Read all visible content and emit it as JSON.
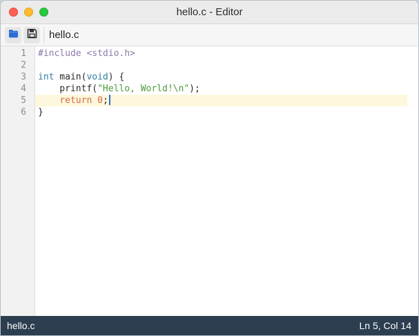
{
  "window": {
    "title": "hello.c - Editor"
  },
  "toolbar": {
    "open_icon": "folder-icon",
    "save_icon": "floppy-save-icon",
    "filename": "hello.c"
  },
  "editor": {
    "line_numbers": [
      "1",
      "2",
      "3",
      "4",
      "5",
      "6"
    ],
    "lines": [
      {
        "segments": [
          {
            "text": "#include <stdio.h>",
            "style": "pp"
          }
        ]
      },
      {
        "segments": []
      },
      {
        "segments": [
          {
            "text": "int",
            "style": "kw"
          },
          {
            "text": " main(",
            "style": ""
          },
          {
            "text": "void",
            "style": "kw"
          },
          {
            "text": ") {",
            "style": ""
          }
        ]
      },
      {
        "segments": [
          {
            "text": "    printf(",
            "style": ""
          },
          {
            "text": "\"Hello, World!\\n\"",
            "style": "str"
          },
          {
            "text": ");",
            "style": ""
          }
        ]
      },
      {
        "segments": [
          {
            "text": "    ",
            "style": ""
          },
          {
            "text": "return",
            "style": "ret"
          },
          {
            "text": " ",
            "style": ""
          },
          {
            "text": "0",
            "style": "ret"
          },
          {
            "text": ";",
            "style": ""
          }
        ],
        "active": true,
        "cursor": true
      },
      {
        "segments": [
          {
            "text": "}",
            "style": ""
          }
        ]
      }
    ]
  },
  "statusbar": {
    "filename": "hello.c",
    "position": "Ln 5, Col 14"
  },
  "colors": {
    "statusbar_bg": "#2c3e50",
    "active_line": "#fdf7dd",
    "keyword": "#2f7f9f",
    "preprocessor": "#8c78a8",
    "string": "#4d9a3c",
    "return": "#d46c3e",
    "cursor": "#2c6fd0"
  }
}
